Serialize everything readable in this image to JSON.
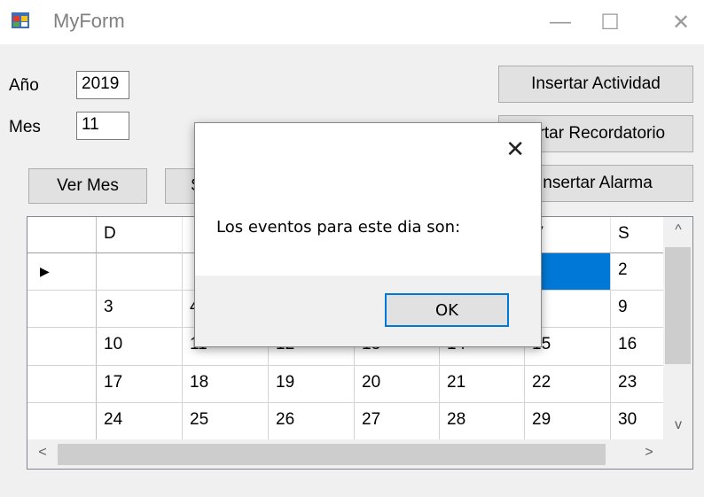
{
  "window": {
    "title": "MyForm",
    "minimize_glyph": "—",
    "maximize_glyph": "☐",
    "close_glyph": "✕"
  },
  "form": {
    "year_label": "Año",
    "year_value": "2019",
    "month_label": "Mes",
    "month_value": "11",
    "buttons": {
      "ver_mes": "Ver Mes",
      "second": "S",
      "insertar_actividad": "Insertar Actividad",
      "insertar_recordatorio": "ertar Recordatorio",
      "insertar_alarma": "Insertar Alarma"
    }
  },
  "calendar": {
    "headers": [
      "D",
      "",
      "",
      "",
      "",
      "V",
      "S"
    ],
    "rows": [
      [
        "",
        "",
        "",
        "",
        "",
        "",
        "2"
      ],
      [
        "3",
        "4",
        "",
        "",
        "",
        "",
        "9"
      ],
      [
        "10",
        "11",
        "12",
        "13",
        "14",
        "15",
        "16"
      ],
      [
        "17",
        "18",
        "19",
        "20",
        "21",
        "22",
        "23"
      ],
      [
        "24",
        "25",
        "26",
        "27",
        "28",
        "29",
        "30"
      ]
    ],
    "current_row_glyph": "▶",
    "scroll_up": "^",
    "scroll_down": "v",
    "scroll_left": "<",
    "scroll_right": ">"
  },
  "dialog": {
    "message": "Los eventos para este dia son:",
    "ok_label": "OK",
    "close_glyph": "✕"
  }
}
